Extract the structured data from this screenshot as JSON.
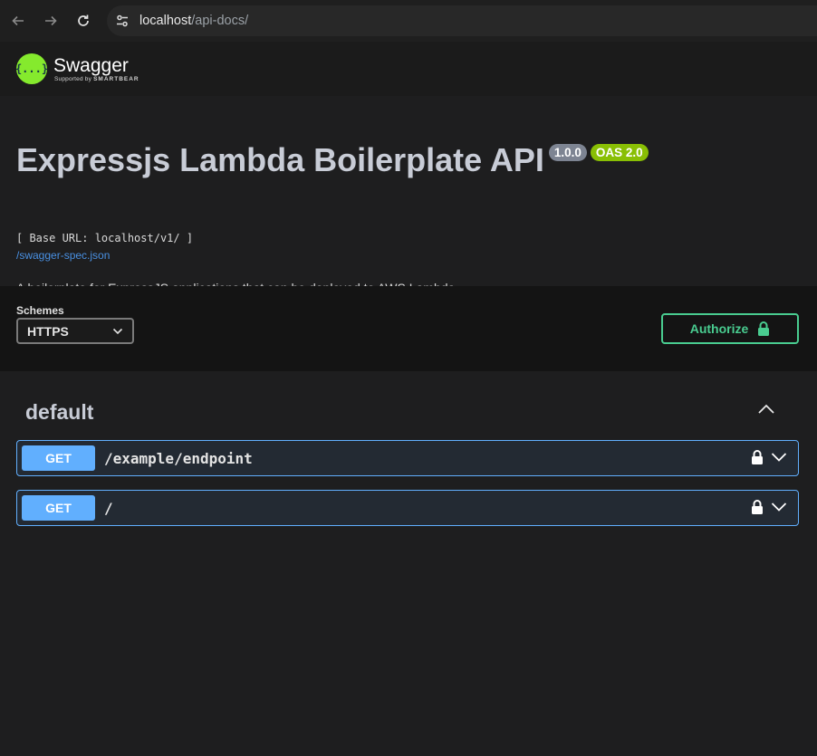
{
  "browser": {
    "host": "localhost",
    "path": "/api-docs/"
  },
  "topbar": {
    "logo_name": "Swagger",
    "logo_sub_prefix": "Supported by",
    "logo_sub_brand": "SMARTBEAR",
    "logo_mark": "{...}"
  },
  "info": {
    "title": "Expressjs Lambda Boilerplate API",
    "version_badge": "1.0.0",
    "oas_badge": "OAS 2.0",
    "base_url": "[ Base URL: localhost/v1/ ]",
    "spec_link": "/swagger-spec.json",
    "description": "A boilerplate for ExpressJS applications that can be deployed to AWS Lambda"
  },
  "schemes": {
    "label": "Schemes",
    "selected": "HTTPS"
  },
  "authorize": {
    "label": "Authorize",
    "icon": "lock-icon"
  },
  "tag": {
    "name": "default",
    "expanded": true
  },
  "operations": [
    {
      "method": "GET",
      "path": "/example/endpoint"
    },
    {
      "method": "GET",
      "path": "/"
    }
  ],
  "colors": {
    "get_method": "#61affe",
    "authorize": "#49cc90",
    "oas_badge": "#89bf04",
    "logo": "#85ea2d"
  }
}
